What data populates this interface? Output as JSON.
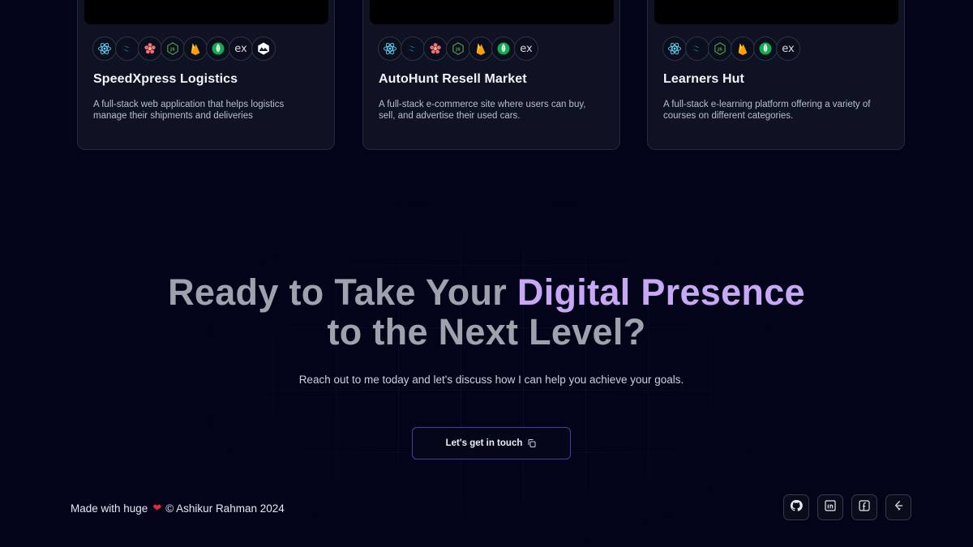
{
  "projects": [
    {
      "title": "SpeedXpress Logistics",
      "description": "A full-stack web application that helps logistics manage their shipments and deliveries",
      "thumb_strip_color": "#c9a13a",
      "tech_icons": [
        "react-icon",
        "tailwind-icon",
        "redux-saga-icon",
        "nodejs-icon",
        "firebase-icon",
        "mongodb-icon",
        "express-icon",
        "mui-icon"
      ]
    },
    {
      "title": "AutoHunt Resell Market",
      "description": "A full-stack e-commerce site where users can buy, sell, and advertise their used cars.",
      "thumb_strip_color": "#6a6f88",
      "tech_icons": [
        "react-icon",
        "tailwind-icon",
        "redux-saga-icon",
        "nodejs-icon",
        "firebase-icon",
        "mongodb-icon",
        "express-icon"
      ]
    },
    {
      "title": "Learners Hut",
      "description": "A full-stack e-learning platform offering a variety of courses on different categories.",
      "thumb_strip_color": "#4a8a5a",
      "tech_icons": [
        "react-icon",
        "tailwind-icon",
        "nodejs-icon",
        "firebase-icon",
        "mongodb-icon",
        "express-icon"
      ]
    }
  ],
  "cta": {
    "title_part1": "Ready to Take Your ",
    "title_accent": "Digital Presence",
    "title_part2": "to the Next Level?",
    "subtitle": "Reach out to me today and let's discuss how I can help you achieve your goals.",
    "button_label": "Let's get in touch",
    "accent_color": "#c8a8f5"
  },
  "footer": {
    "made_with": "Made with huge",
    "copyright": "© Ashikur Rahman 2024",
    "social_icons": [
      "github-icon",
      "linkedin-icon",
      "facebook-icon",
      "leetcode-icon"
    ]
  }
}
